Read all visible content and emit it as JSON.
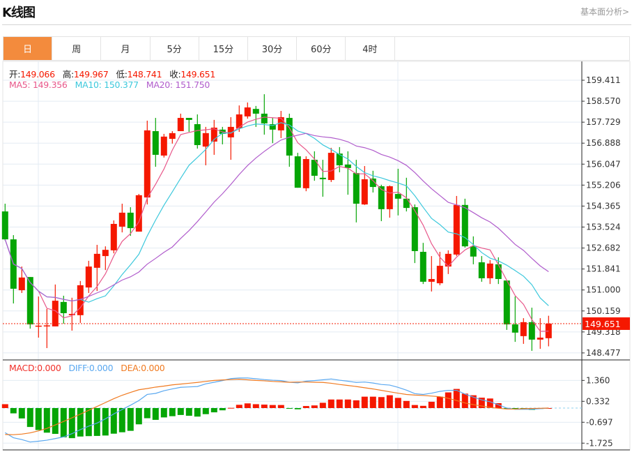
{
  "header": {
    "title": "K线图",
    "more_link": "基本面分析>"
  },
  "tabs": [
    {
      "label": "日",
      "active": true
    },
    {
      "label": "周"
    },
    {
      "label": "月"
    },
    {
      "label": "5分"
    },
    {
      "label": "15分"
    },
    {
      "label": "30分"
    },
    {
      "label": "60分"
    },
    {
      "label": "4时"
    }
  ],
  "info": {
    "open_label": "开:",
    "open": "149.066",
    "high_label": "高:",
    "high": "149.967",
    "low_label": "低:",
    "low": "148.741",
    "close_label": "收:",
    "close": "149.651",
    "ma5": "MA5: 149.356",
    "ma10": "MA10: 150.377",
    "ma20": "MA20: 151.750",
    "macd": "MACD:0.000",
    "diff": "DIFF:0.000",
    "dea": "DEA:0.000"
  },
  "colors": {
    "up": "#f51800",
    "down": "#05a505",
    "ma5": "#e8578a",
    "ma10": "#3cc8dc",
    "ma20": "#b05ccc",
    "diff": "#5aa8f0",
    "dea": "#f07a20",
    "accent": "#f38b3d"
  },
  "chart_data": [
    {
      "type": "candlestick",
      "ohlc_order": [
        "open",
        "high",
        "low",
        "close"
      ],
      "candles": [
        [
          154.15,
          154.46,
          152.98,
          153.03
        ],
        [
          153.03,
          153.2,
          150.46,
          151.05
        ],
        [
          150.99,
          151.94,
          150.88,
          151.5
        ],
        [
          151.52,
          151.52,
          149.45,
          149.62
        ],
        [
          149.57,
          150.74,
          149.09,
          149.57
        ],
        [
          149.57,
          150.24,
          148.67,
          149.58
        ],
        [
          149.54,
          151.22,
          149.54,
          150.57
        ],
        [
          150.52,
          150.77,
          149.65,
          150.07
        ],
        [
          149.99,
          150.69,
          149.37,
          150.04
        ],
        [
          149.99,
          151.36,
          149.68,
          151.19
        ],
        [
          151.1,
          152.17,
          150.88,
          151.94
        ],
        [
          151.89,
          152.81,
          150.96,
          152.45
        ],
        [
          152.36,
          152.75,
          151.8,
          152.61
        ],
        [
          152.59,
          153.79,
          152.47,
          153.65
        ],
        [
          153.54,
          154.46,
          153.31,
          154.1
        ],
        [
          154.1,
          154.32,
          153.17,
          153.48
        ],
        [
          153.34,
          154.85,
          153.34,
          154.8
        ],
        [
          154.71,
          157.79,
          154.43,
          157.4
        ],
        [
          157.37,
          157.9,
          155.94,
          156.42
        ],
        [
          156.39,
          157.26,
          156.31,
          157.15
        ],
        [
          157.06,
          157.37,
          156.87,
          157.29
        ],
        [
          157.37,
          158.07,
          157.37,
          157.9
        ],
        [
          157.9,
          157.9,
          157.34,
          157.82
        ],
        [
          157.65,
          158.04,
          156.67,
          156.81
        ],
        [
          156.75,
          157.54,
          156.0,
          157.29
        ],
        [
          156.95,
          157.82,
          156.42,
          157.51
        ],
        [
          157.43,
          157.54,
          156.84,
          157.26
        ],
        [
          157.12,
          157.93,
          156.22,
          157.54
        ],
        [
          157.48,
          158.4,
          157.34,
          158.04
        ],
        [
          157.96,
          158.52,
          157.87,
          158.32
        ],
        [
          158.26,
          158.38,
          157.54,
          158.07
        ],
        [
          158.07,
          158.85,
          157.23,
          157.68
        ],
        [
          157.65,
          157.9,
          156.89,
          157.43
        ],
        [
          157.4,
          158.18,
          157.09,
          157.93
        ],
        [
          157.9,
          158.07,
          155.94,
          156.39
        ],
        [
          156.36,
          156.5,
          155.1,
          155.1
        ],
        [
          155.08,
          156.36,
          154.96,
          156.25
        ],
        [
          156.22,
          156.56,
          155.38,
          155.58
        ],
        [
          155.5,
          156.22,
          154.74,
          155.44
        ],
        [
          155.41,
          156.7,
          155.33,
          156.5
        ],
        [
          156.47,
          156.73,
          155.72,
          156.0
        ],
        [
          156.03,
          156.56,
          154.82,
          155.89
        ],
        [
          155.69,
          156.22,
          153.71,
          154.46
        ],
        [
          154.43,
          155.97,
          154.41,
          155.44
        ],
        [
          155.47,
          155.78,
          154.91,
          155.13
        ],
        [
          155.16,
          155.22,
          153.76,
          154.24
        ],
        [
          154.24,
          155.19,
          153.9,
          155.16
        ],
        [
          154.85,
          155.86,
          153.99,
          154.66
        ],
        [
          154.66,
          155.5,
          154.15,
          154.29
        ],
        [
          154.32,
          154.43,
          152.08,
          152.56
        ],
        [
          152.53,
          152.89,
          151.24,
          151.33
        ],
        [
          151.33,
          152.36,
          150.94,
          151.44
        ],
        [
          151.27,
          152.53,
          151.19,
          151.97
        ],
        [
          151.94,
          152.59,
          151.64,
          152.45
        ],
        [
          152.42,
          154.77,
          152.36,
          154.41
        ],
        [
          154.41,
          154.66,
          152.7,
          152.75
        ],
        [
          152.75,
          153.15,
          152.03,
          152.34
        ],
        [
          152.11,
          152.36,
          151.33,
          151.47
        ],
        [
          151.47,
          152.2,
          151.24,
          152.06
        ],
        [
          152.03,
          152.31,
          151.24,
          151.44
        ],
        [
          151.38,
          151.38,
          149.4,
          149.62
        ],
        [
          149.62,
          150.74,
          148.92,
          149.29
        ],
        [
          149.15,
          149.87,
          148.84,
          149.71
        ],
        [
          149.71,
          150.29,
          148.56,
          149.01
        ],
        [
          149.01,
          149.87,
          148.64,
          149.09
        ],
        [
          149.066,
          149.967,
          148.741,
          149.651
        ]
      ],
      "moving_averages": [
        {
          "name": "MA5",
          "period": 5
        },
        {
          "name": "MA10",
          "period": 10
        },
        {
          "name": "MA20",
          "period": 20
        }
      ],
      "last_price": "149.651",
      "y_ticks": [
        "159.411",
        "158.570",
        "157.729",
        "156.888",
        "156.047",
        "155.206",
        "154.365",
        "153.524",
        "152.682",
        "151.841",
        "151.000",
        "150.159",
        "149.318",
        "148.477"
      ],
      "ylim": [
        148.2,
        159.8
      ],
      "grid": true
    },
    {
      "type": "bar+line",
      "name": "MACD",
      "histogram": [
        0.19,
        -0.26,
        -0.51,
        -0.93,
        -1.08,
        -1.21,
        -1.27,
        -1.44,
        -1.48,
        -1.4,
        -1.38,
        -1.37,
        -1.35,
        -1.26,
        -1.19,
        -1.12,
        -0.8,
        -0.5,
        -0.58,
        -0.46,
        -0.4,
        -0.34,
        -0.38,
        -0.42,
        -0.3,
        -0.21,
        -0.11,
        0.01,
        0.16,
        0.23,
        0.19,
        0.17,
        0.15,
        0.15,
        -0.02,
        -0.06,
        0.1,
        0.13,
        0.26,
        0.42,
        0.42,
        0.42,
        0.38,
        0.56,
        0.56,
        0.54,
        0.63,
        0.5,
        0.35,
        0.15,
        0.11,
        0.31,
        0.56,
        0.77,
        0.94,
        0.71,
        0.63,
        0.51,
        0.47,
        0.24,
        -0.02,
        -0.03,
        -0.03,
        -0.09,
        -0.04,
        0.0
      ],
      "series": [
        {
          "name": "DIFF",
          "values": [
            -1.21,
            -1.46,
            -1.55,
            -1.67,
            -1.63,
            -1.58,
            -1.5,
            -1.42,
            -1.26,
            -1.06,
            -0.89,
            -0.74,
            -0.53,
            -0.29,
            -0.07,
            0.14,
            0.37,
            0.67,
            0.72,
            0.85,
            0.94,
            1.02,
            1.04,
            1.06,
            1.19,
            1.27,
            1.35,
            1.45,
            1.48,
            1.48,
            1.44,
            1.4,
            1.37,
            1.35,
            1.27,
            1.24,
            1.32,
            1.35,
            1.39,
            1.43,
            1.37,
            1.32,
            1.26,
            1.28,
            1.23,
            1.16,
            1.13,
            1.02,
            0.88,
            0.71,
            0.67,
            0.73,
            0.82,
            0.87,
            0.87,
            0.69,
            0.54,
            0.4,
            0.31,
            0.16,
            0.0,
            -0.06,
            -0.06,
            -0.06,
            -0.03,
            0.0
          ]
        },
        {
          "name": "DEA",
          "values": [
            -1.3,
            -1.31,
            -1.28,
            -1.22,
            -1.12,
            -1.0,
            -0.83,
            -0.66,
            -0.48,
            -0.3,
            -0.11,
            0.08,
            0.27,
            0.46,
            0.63,
            0.77,
            0.9,
            0.96,
            1.03,
            1.08,
            1.14,
            1.18,
            1.22,
            1.26,
            1.31,
            1.36,
            1.38,
            1.4,
            1.42,
            1.39,
            1.36,
            1.34,
            1.31,
            1.29,
            1.27,
            1.28,
            1.28,
            1.27,
            1.26,
            1.22,
            1.16,
            1.11,
            1.06,
            1.0,
            0.94,
            0.87,
            0.8,
            0.73,
            0.67,
            0.64,
            0.62,
            0.59,
            0.56,
            0.48,
            0.37,
            0.25,
            0.17,
            0.1,
            0.03,
            -0.01,
            -0.05,
            -0.05,
            -0.03,
            -0.02,
            -0.01,
            0.0
          ]
        }
      ],
      "y_ticks": [
        "1.360",
        "0.332",
        "-0.697",
        "-1.725"
      ],
      "grid": true
    }
  ]
}
